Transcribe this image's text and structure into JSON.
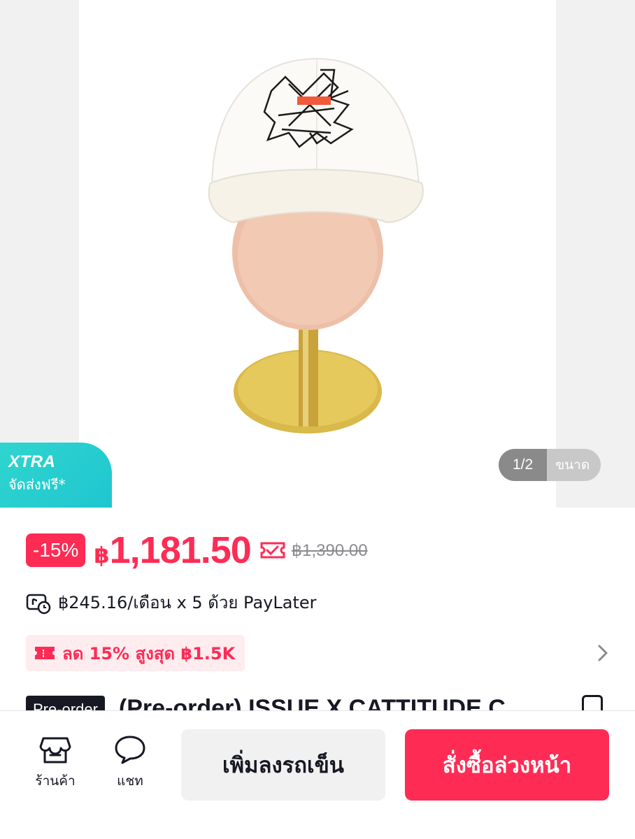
{
  "gallery": {
    "pager_count": "1/2",
    "pager_size_label": "ขนาด",
    "badge_line1": "XTRA",
    "badge_line2": "จัดส่งฟรี*"
  },
  "price": {
    "discount": "-15%",
    "currency": "฿",
    "value": "1,181.50",
    "original": "฿1,390.00",
    "accent_color": "#fe2c55"
  },
  "paylater": {
    "text": "฿245.16/เดือน x 5 ด้วย PayLater"
  },
  "promo": {
    "text": "ลด 15% สูงสุด ฿1.5K"
  },
  "product": {
    "badge": "Pre-order",
    "title": "(Pre-order) ISSUE X CATTITUDE C"
  },
  "bottom_bar": {
    "shop_label": "ร้านค้า",
    "chat_label": "แชท",
    "add_to_cart": "เพิ่มลงรถเข็น",
    "preorder_buy": "สั่งซื้อล่วงหน้า"
  }
}
